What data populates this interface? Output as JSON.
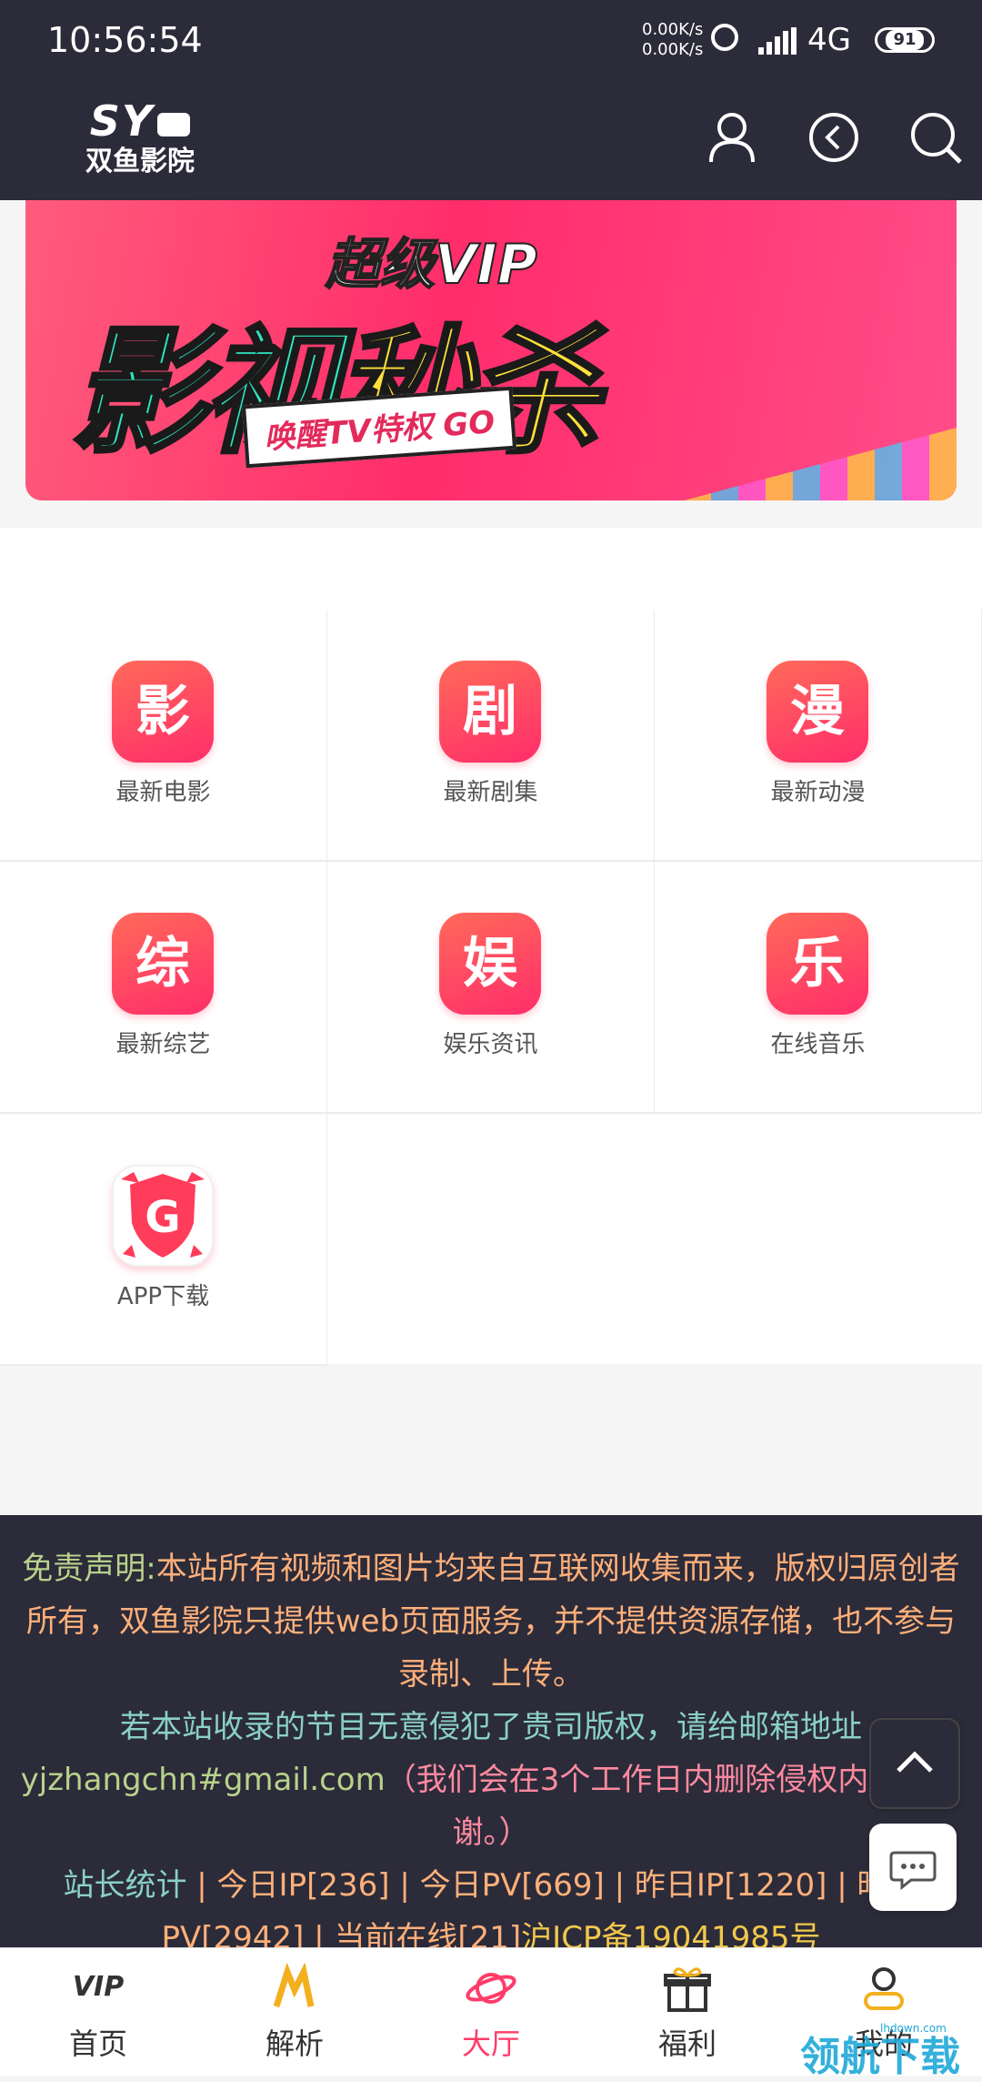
{
  "status_bar": {
    "time": "10:56:54",
    "net_up": "0.00K/s",
    "net_down": "0.00K/s",
    "network": "4G",
    "battery": "91"
  },
  "header": {
    "logo_mark": "SY",
    "logo_name": "双鱼影院",
    "icons": [
      "user-icon",
      "history-icon",
      "search-icon"
    ]
  },
  "banner": {
    "line1": "超级VIP",
    "line2a": "影视",
    "line2b": "秒杀",
    "tag": "唤醒TV特权 GO"
  },
  "grid": [
    {
      "icon_text": "影",
      "label": "最新电影"
    },
    {
      "icon_text": "剧",
      "label": "最新剧集"
    },
    {
      "icon_text": "漫",
      "label": "最新动漫"
    },
    {
      "icon_text": "综",
      "label": "最新综艺"
    },
    {
      "icon_text": "娱",
      "label": "娱乐资讯"
    },
    {
      "icon_text": "乐",
      "label": "在线音乐"
    },
    {
      "icon_text": "G",
      "label": "APP下载"
    }
  ],
  "disclaimer": {
    "p1a": "免责声明:",
    "p1b": "本站所有视频和图片均来自互联网收集而来，版权归原创者所有，双鱼影院只提供web页面服务，并不提供资源存储，也不参与录制、上传。",
    "p2a": "若本站收录的节目无意侵犯了贵司版权，请给邮箱地址",
    "p2b": "yjzhangchn#gmail.com",
    "p2c": "（我们会在3个工作日内删除侵权内容，谢谢。）",
    "p3a": "站长统计",
    "p3b": " | 今日IP[236] | 今日PV[669] | 昨日IP[1220] | 昨日PV[2942] | 当前在线[21]",
    "p3c": "沪ICP备19041985号"
  },
  "bottom_nav": [
    {
      "label": "首页",
      "icon": "vip-icon",
      "active": false
    },
    {
      "label": "解析",
      "icon": "m-logo-icon",
      "active": false
    },
    {
      "label": "大厅",
      "icon": "planet-icon",
      "active": true
    },
    {
      "label": "福利",
      "icon": "gift-icon",
      "active": false
    },
    {
      "label": "我的",
      "icon": "user-icon",
      "active": false
    }
  ],
  "watermark": "领航下载",
  "watermark_small": "lhdown.com",
  "colors": {
    "accent": "#ff3c6a",
    "dark": "#2b2b3a"
  }
}
